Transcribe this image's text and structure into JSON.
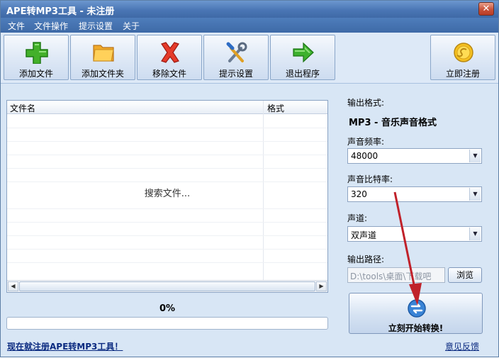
{
  "window": {
    "title": "APE转MP3工具 - 未注册",
    "close_glyph": "✕"
  },
  "menu": [
    "文件",
    "文件操作",
    "提示设置",
    "关于"
  ],
  "toolbar": {
    "add_file": "添加文件",
    "add_folder": "添加文件夹",
    "remove_file": "移除文件",
    "prompt_settings": "提示设置",
    "exit": "退出程序",
    "register": "立即注册"
  },
  "file_list": {
    "col_name": "文件名",
    "col_format": "格式",
    "status": "搜索文件..."
  },
  "progress": {
    "percent_text": "0%",
    "value": 0
  },
  "register_link": "现在就注册APE转MP3工具！",
  "output": {
    "format_label": "输出格式:",
    "format_value": "MP3 - 音乐声音格式",
    "sample_rate_label": "声音频率:",
    "sample_rate_value": "48000",
    "bitrate_label": "声音比特率:",
    "bitrate_value": "320",
    "channel_label": "声道:",
    "channel_value": "双声道",
    "path_label": "输出路径:",
    "path_value": "D:\\tools\\桌面\\下载吧",
    "browse": "浏览",
    "convert": "立刻开始转换!"
  },
  "feedback_link": "意见反馈",
  "colors": {
    "accent": "#4a76b5",
    "arrow": "#c0212a"
  },
  "icons": [
    "plus-icon",
    "folder-icon",
    "remove-x-icon",
    "tools-icon",
    "exit-arrow-icon",
    "coin-icon",
    "convert-icon",
    "chevron-down-icon"
  ]
}
